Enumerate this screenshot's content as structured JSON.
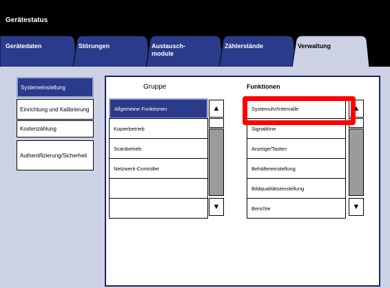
{
  "app": {
    "title": "Gerätestatus"
  },
  "tabs": [
    {
      "label": "Gerätedaten",
      "active": false
    },
    {
      "label": "Störungen",
      "active": false
    },
    {
      "label": "Austausch-\nmodule",
      "active": false
    },
    {
      "label": "Zählerstände",
      "active": false
    },
    {
      "label": "Verwaltung",
      "active": true
    }
  ],
  "sidebar": {
    "items": [
      {
        "label": "Systemeinstellung",
        "active": true
      },
      {
        "label": "Einrichtung und Kalibrierung",
        "active": false
      },
      {
        "label": "Kostenzählung",
        "active": false
      },
      {
        "label": "Authentifizierung/Sicherheit",
        "active": false
      }
    ]
  },
  "group_column": {
    "header": "Gruppe",
    "items": [
      {
        "label": "Allgemeine Funktionen",
        "selected": true
      },
      {
        "label": "Kopierbetrieb",
        "selected": false
      },
      {
        "label": "Scanbetrieb",
        "selected": false
      },
      {
        "label": "Netzwerk-Controller",
        "selected": false
      },
      {
        "label": "",
        "selected": false
      },
      {
        "label": "",
        "selected": false
      }
    ]
  },
  "function_column": {
    "header": "Funktionen",
    "items": [
      {
        "label": "Systemuhr/Intervalle"
      },
      {
        "label": "Signaltöne"
      },
      {
        "label": "Anzeige/Tasten"
      },
      {
        "label": "Behältereinstellung"
      },
      {
        "label": "Bildqualitätseinstellung"
      },
      {
        "label": "Berichte"
      }
    ]
  },
  "icons": {
    "scroll_up": "arrow-up-icon",
    "scroll_down": "arrow-down-icon"
  },
  "colors": {
    "accent": "#2b3b8b",
    "highlight": "#ff0000",
    "background": "#ccd2e4",
    "tab_bar": "#000000"
  }
}
